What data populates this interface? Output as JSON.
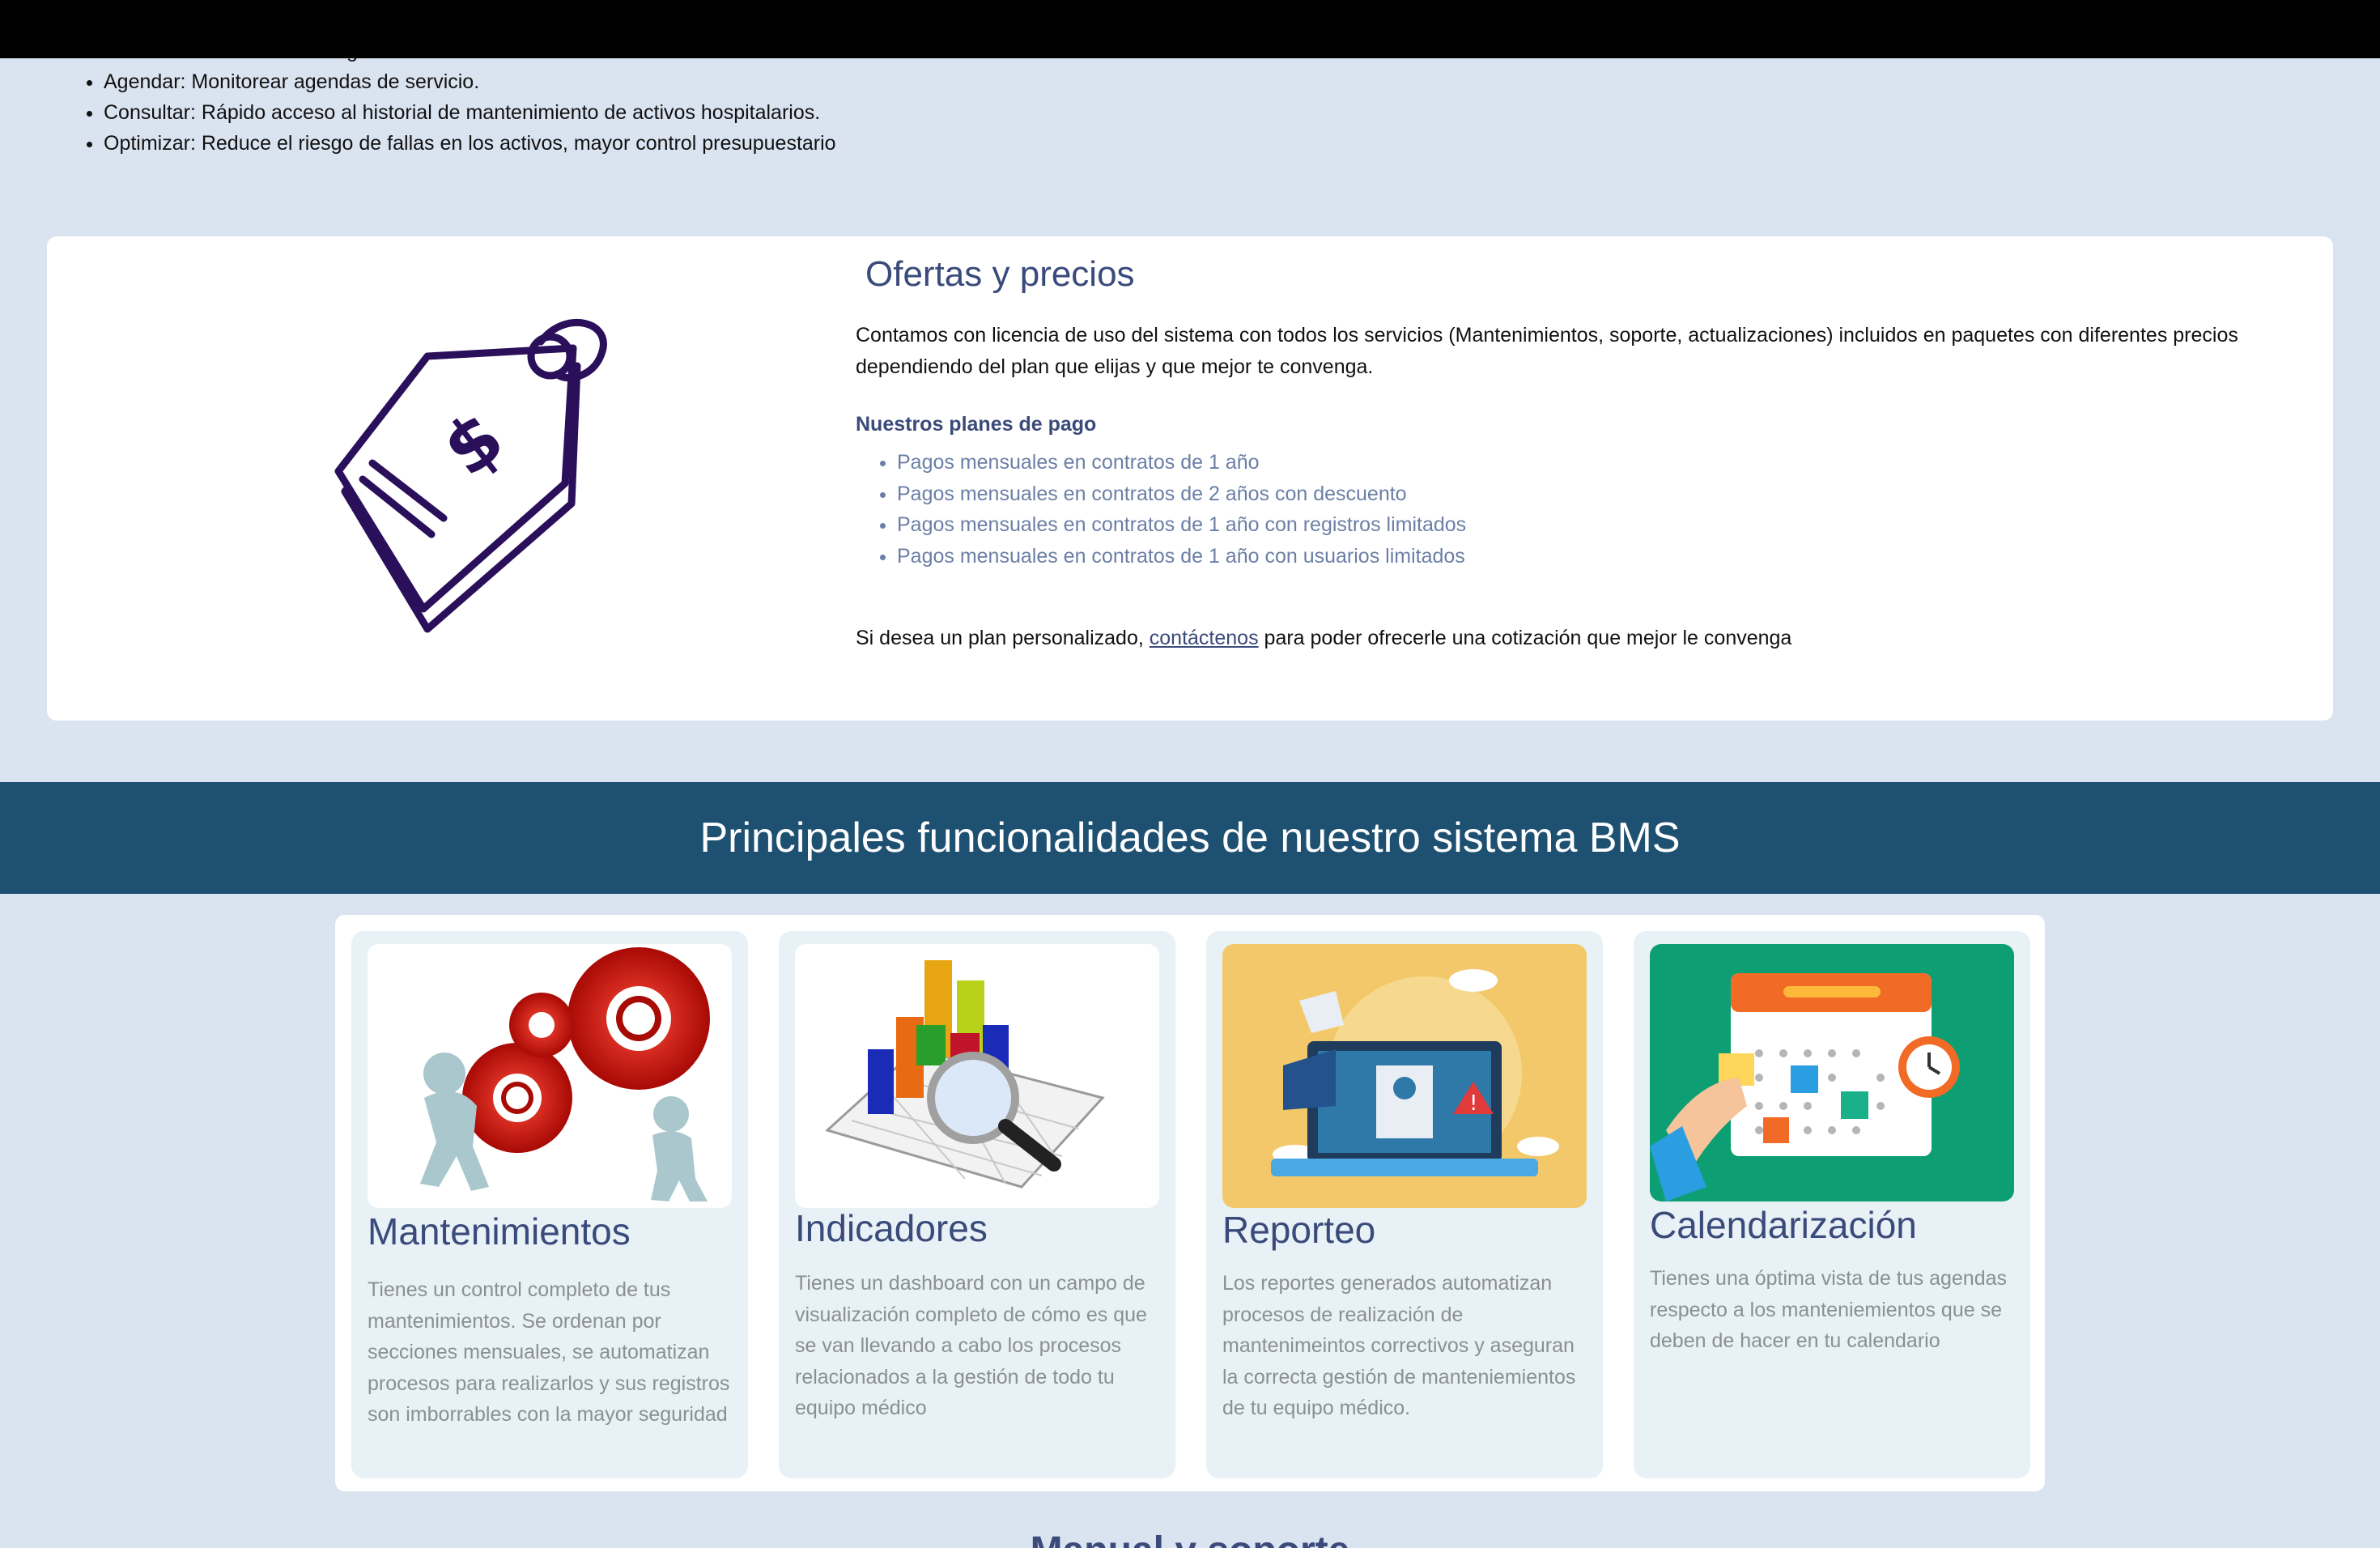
{
  "intro_bullets": [
    "Monitorear: Business Intelligence dashboard",
    "Agendar: Monitorear agendas de servicio.",
    "Consultar: Rápido acceso al historial de mantenimiento de activos hospitalarios.",
    "Optimizar: Reduce el riesgo de fallas en los activos, mayor control presupuestario"
  ],
  "offers": {
    "title": "Ofertas y precios",
    "description": "Contamos con licencia de uso del sistema con todos los servicios (Mantenimientos, soporte, actualizaciones) incluidos en paquetes con diferentes precios dependiendo del plan que elijas y que mejor te convenga.",
    "plans_heading": "Nuestros planes de pago",
    "plans": [
      "Pagos mensuales en contratos de 1 año",
      "Pagos mensuales en contratos de 2 años con descuento",
      "Pagos mensuales en contratos de 1 año con registros limitados",
      "Pagos mensuales en contratos de 1 año con usuarios limitados"
    ],
    "custom_prefix": "Si desea un plan personalizado, ",
    "custom_link": "contáctenos",
    "custom_suffix": " para poder ofrecerle una cotización que mejor le convenga",
    "icon": "price-tag-icon"
  },
  "banner": {
    "title": "Principales funcionalidades de nuestro sistema BMS"
  },
  "features": [
    {
      "title": "Mantenimientos",
      "text": "Tienes un control completo de tus mantenimientos. Se ordenan por secciones mensuales, se automatizan procesos para realizarlos y sus registros son imborrables con la mayor seguridad"
    },
    {
      "title": "Indicadores",
      "text": "Tienes un dashboard con un campo de visualización completo de cómo es que se van llevando a cabo los procesos relacionados a la gestión de todo tu equipo médico"
    },
    {
      "title": "Reporteo",
      "text": "Los reportes generados automatizan procesos de realización de mantenimeintos correctivos y aseguran la correcta gestión de manteniemientos de tu equipo médico."
    },
    {
      "title": "Calendarización",
      "text": "Tienes una óptima vista de tus agendas respecto a los manteniemientos que se deben de hacer en tu calendario"
    }
  ],
  "bottom_heading": "Manual y soporte"
}
